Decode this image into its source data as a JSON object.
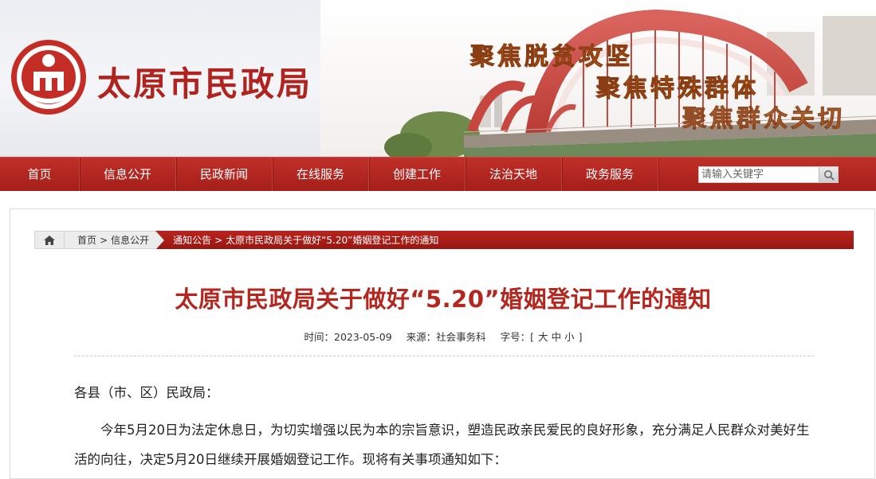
{
  "banner": {
    "site_title": "太原市民政局",
    "slogans": [
      "聚焦脱贫攻坚",
      "聚焦特殊群体",
      "聚焦群众关切"
    ],
    "brand_color": "#b0231e",
    "slogan_color": "#f0a21a"
  },
  "nav": {
    "items": [
      "首页",
      "信息公开",
      "民政新闻",
      "在线服务",
      "创建工作",
      "法治天地",
      "政务服务"
    ],
    "search_placeholder": "请输入关键字",
    "color": "#a51e19"
  },
  "breadcrumb": {
    "home_icon": "home-icon",
    "items": [
      "首页",
      "信息公开",
      "通知公告",
      "太原市民政局关于做好“5.20”婚姻登记工作的通知"
    ],
    "separator": ">"
  },
  "article": {
    "title": "太原市民政局关于做好“5.20”婚姻登记工作的通知",
    "meta": {
      "time_label": "时间：",
      "time_value": "2023-05-09",
      "source_label": "来源：",
      "source_value": "社会事务科",
      "font_label": "字号：",
      "bracket_open": "[",
      "bracket_close": "]",
      "font_sizes": [
        "大",
        "中",
        "小"
      ]
    },
    "salutation": "各县（市、区）民政局：",
    "paragraph_1": "今年5月20日为法定休息日，为切实增强以民为本的宗旨意识，塑造民政亲民爱民的良好形象，充分满足人民群众对美好生活的向往，决定5月20日继续开展婚姻登记工作。现将有关事项通知如下："
  }
}
